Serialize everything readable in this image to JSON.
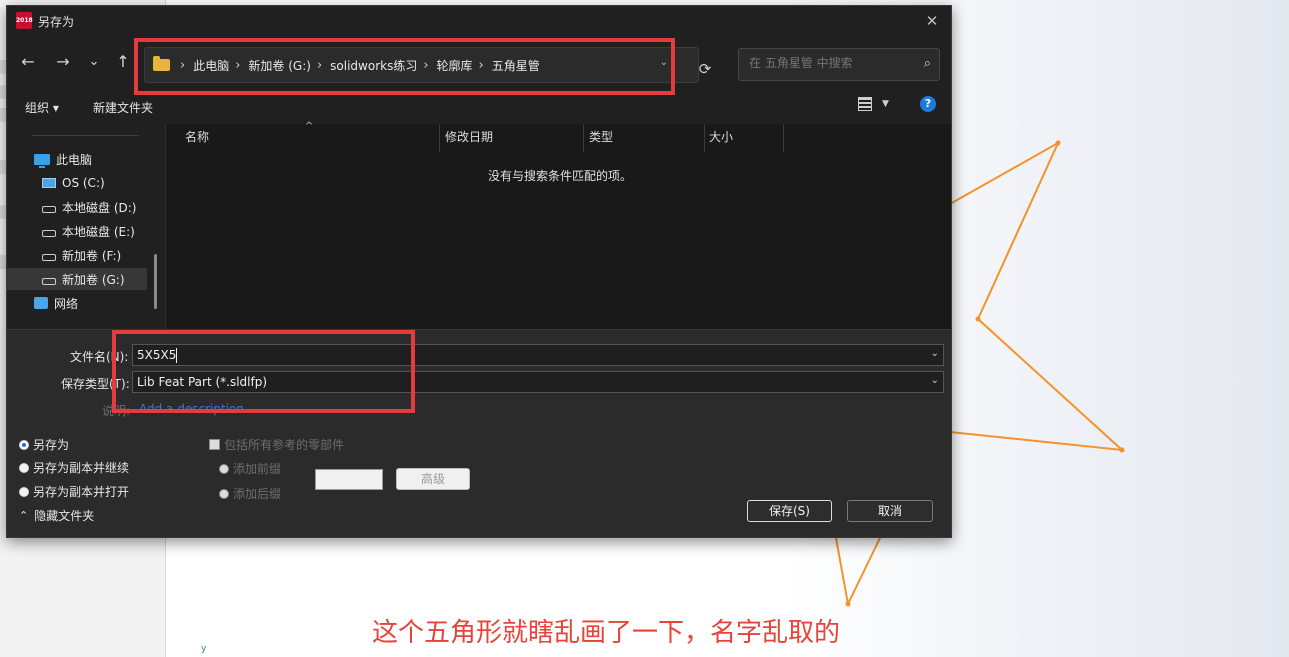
{
  "dialog": {
    "title": "另存为",
    "app_badge": "2018"
  },
  "nav": {
    "back": "←",
    "forward": "→",
    "recent": "⌄",
    "up": "↑",
    "refresh": "⟳",
    "breadcrumbs": [
      "此电脑",
      "新加卷 (G:)",
      "solidworks练习",
      "轮廓库",
      "五角星管"
    ],
    "search_placeholder": "在 五角星管 中搜索"
  },
  "toolbar": {
    "organize": "组织 ▾",
    "new_folder": "新建文件夹"
  },
  "sidebar": {
    "items": [
      {
        "label": "此电脑",
        "icon": "computer-icon"
      },
      {
        "label": "OS (C:)",
        "icon": "windows-drive-icon"
      },
      {
        "label": "本地磁盘 (D:)",
        "icon": "drive-icon"
      },
      {
        "label": "本地磁盘 (E:)",
        "icon": "drive-icon"
      },
      {
        "label": "新加卷 (F:)",
        "icon": "drive-icon"
      },
      {
        "label": "新加卷 (G:)",
        "icon": "drive-icon",
        "selected": true
      },
      {
        "label": "网络",
        "icon": "network-icon"
      }
    ]
  },
  "file_list": {
    "columns": [
      "名称",
      "修改日期",
      "类型",
      "大小"
    ],
    "empty_message": "没有与搜索条件匹配的项。"
  },
  "form": {
    "filename_label": "文件名(N):",
    "filename_value": "5X5X5",
    "filetype_label": "保存类型(T):",
    "filetype_value": "Lib Feat Part (*.sldlfp)",
    "description_label": "说明:",
    "description_link": "Add a description",
    "save_options": [
      "另存为",
      "另存为副本并继续",
      "另存为副本并打开"
    ],
    "include_refs": "包括所有参考的零部件",
    "add_prefix": "添加前缀",
    "add_suffix": "添加后缀",
    "advanced": "高级",
    "save": "保存(S)",
    "cancel": "取消",
    "hide_folders": "隐藏文件夹"
  },
  "annotation": {
    "text": "这个五角形就瞎乱画了一下，名字乱取的",
    "color": "#e8433b"
  },
  "colors": {
    "sketch_line": "#f5922a",
    "highlight": "#e43c3c",
    "dialog_bg": "#202020"
  }
}
